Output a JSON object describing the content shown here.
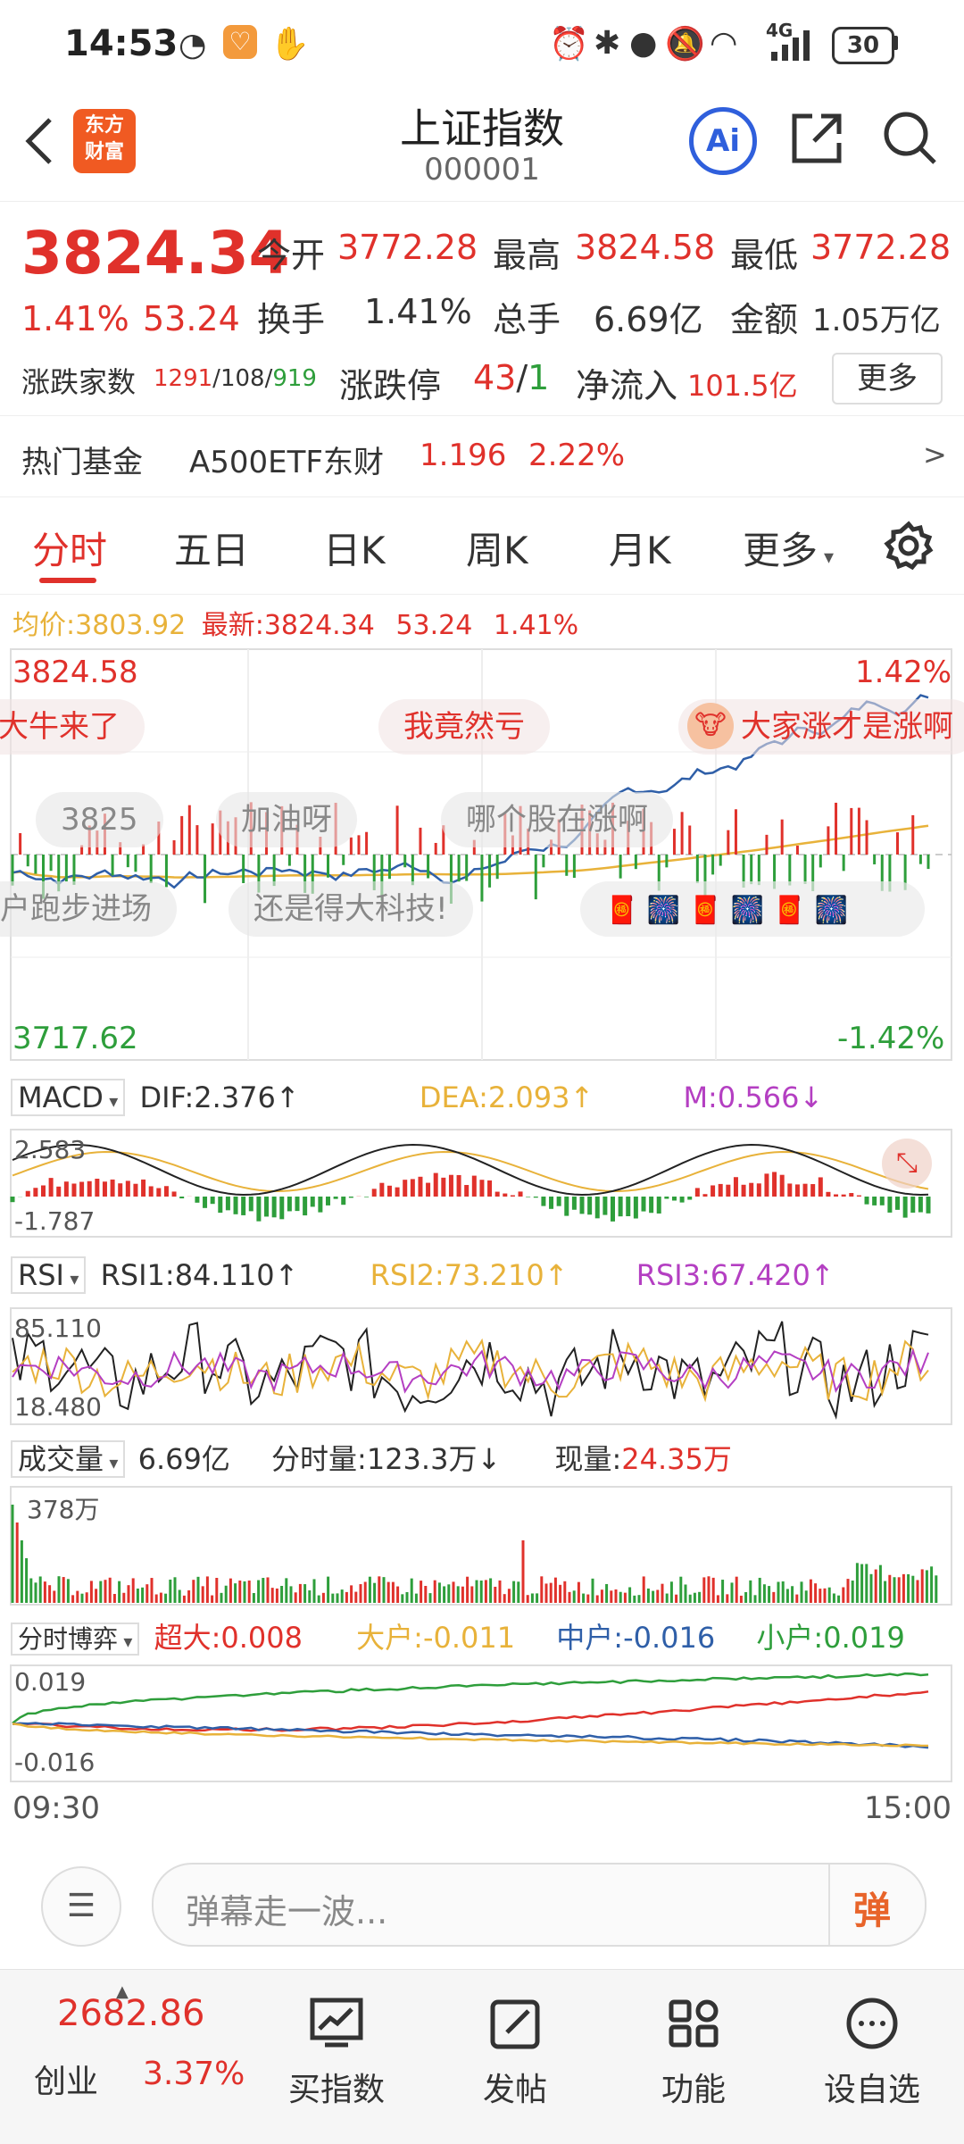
{
  "status": {
    "time": "14:53",
    "battery": "30",
    "network": "4G"
  },
  "nav": {
    "title": "上证指数",
    "code": "000001",
    "logo_text": "东方财富",
    "ai_label": "Ai"
  },
  "quote": {
    "price": "3824.34",
    "change_pct": "1.41%",
    "change": "53.24",
    "open_label": "今开",
    "open": "3772.28",
    "high_label": "最高",
    "high": "3824.58",
    "low_label": "最低",
    "low": "3772.28",
    "turnover_label": "换手",
    "turnover": "1.41%",
    "volume_label": "总手",
    "volume": "6.69亿",
    "amount_label": "金额",
    "amount": "1.05万亿",
    "breadth_label": "涨跌家数",
    "up": "1291",
    "flat": "108",
    "down": "919",
    "limit_label": "涨跌停",
    "limit_up": "43",
    "limit_down": "1",
    "inflow_label": "净流入",
    "inflow": "101.5亿",
    "more": "更多"
  },
  "fund": {
    "label": "热门基金",
    "name": "A500ETF东财",
    "price": "1.196",
    "pct": "2.22%",
    "arrow": ">"
  },
  "tabs": [
    "分时",
    "五日",
    "日K",
    "周K",
    "月K",
    "更多"
  ],
  "price_chart": {
    "avg_label": "均价:",
    "avg": "3803.92",
    "latest_label": "最新:",
    "latest": "3824.34",
    "latest_chg": "53.24",
    "latest_pct": "1.41%",
    "top": "3824.58",
    "top_pct": "1.42%",
    "bottom": "3717.62",
    "bottom_pct": "-1.42%"
  },
  "danmu": [
    "大牛来了",
    "我竟然亏",
    "大家涨才是涨啊",
    "3825",
    "加油呀",
    "哪个股在涨啊",
    "户跑步进场",
    "还是得大科技!"
  ],
  "macd": {
    "name": "MACD",
    "dif": "DIF:2.376↑",
    "dea": "DEA:2.093↑",
    "m": "M:0.566↓",
    "top": "2.583",
    "bottom": "-1.787"
  },
  "rsi": {
    "name": "RSI",
    "rsi1": "RSI1:84.110↑",
    "rsi2": "RSI2:73.210↑",
    "rsi3": "RSI3:67.420↑",
    "top": "85.110",
    "bottom": "18.480"
  },
  "vol": {
    "name": "成交量",
    "total": "6.69亿",
    "period_label": "分时量:",
    "period": "123.3万↓",
    "now_label": "现量:",
    "now": "24.35万",
    "top": "378万"
  },
  "flow": {
    "name": "分时博弈",
    "xl": "超大:0.008",
    "l": "大户:-0.011",
    "m": "中户:-0.016",
    "s": "小户:0.019",
    "top": "0.019",
    "bottom": "-0.016"
  },
  "time_axis": {
    "start": "09:30",
    "end": "15:00"
  },
  "comment": {
    "placeholder": "弹幕走一波...",
    "send": "弹"
  },
  "bottom": {
    "index_value": "2682.86",
    "index_name": "创业",
    "index_pct": "3.37%",
    "items": [
      "买指数",
      "发帖",
      "功能",
      "设自选"
    ]
  },
  "colors": {
    "up": "#e0312b",
    "down": "#2e9e3b",
    "price_line": "#2f5fa8",
    "avg_line": "#e8b23a",
    "rsi3": "#b43fc2",
    "accent_blue": "#2f5fdc"
  }
}
